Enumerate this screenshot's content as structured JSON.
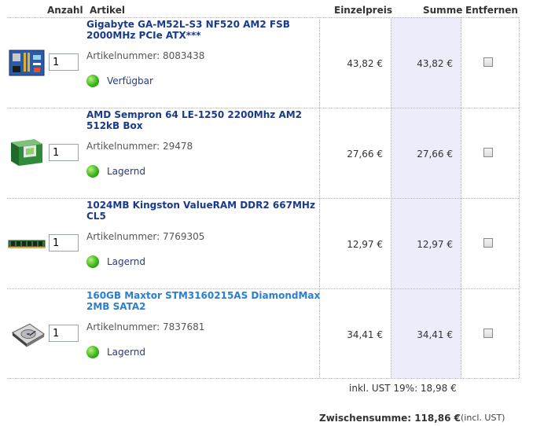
{
  "headers": {
    "quantity": "Anzahl",
    "article": "Artikel",
    "unit_price": "Einzelpreis",
    "sum": "Summe",
    "remove": "Entfernen"
  },
  "items": [
    {
      "title": "Gigabyte GA-M52L-S3 NF520 AM2 FSB 2000MHz PCIe ATX***",
      "qty": "1",
      "artnr": "Artikelnummer: 8083438",
      "status": "Verfügbar",
      "unit_price": "43,82 €",
      "sum": "43,82 €",
      "thumb_icon": "motherboard-icon"
    },
    {
      "title": "AMD Sempron 64 LE-1250 2200Mhz AM2 512kB Box",
      "qty": "1",
      "artnr": "Artikelnummer: 29478",
      "status": "Lagernd",
      "unit_price": "27,66 €",
      "sum": "27,66 €",
      "thumb_icon": "cpu-box-icon"
    },
    {
      "title": "1024MB Kingston ValueRAM DDR2 667MHz CL5",
      "qty": "1",
      "artnr": "Artikelnummer: 7769305",
      "status": "Lagernd",
      "unit_price": "12,97 €",
      "sum": "12,97 €",
      "thumb_icon": "ram-module-icon"
    },
    {
      "title": "160GB Maxtor STM3160215AS DiamondMax 2MB SATA2",
      "qty": "1",
      "artnr": "Artikelnummer: 7837681",
      "status": "Lagernd",
      "unit_price": "34,41 €",
      "sum": "34,41 €",
      "thumb_icon": "hard-drive-icon"
    }
  ],
  "footer": {
    "vat": "inkl. UST 19%: 18,98 €",
    "subtotal": "Zwischensumme: 118,86 €",
    "subtotal_note": "(incl. UST)"
  },
  "colors": {
    "title_link": "#1a3a8a",
    "title_link_hover": "#2a7fd0",
    "sum_column_bg": "#ececfa",
    "status_dot": "#3cb51e"
  }
}
